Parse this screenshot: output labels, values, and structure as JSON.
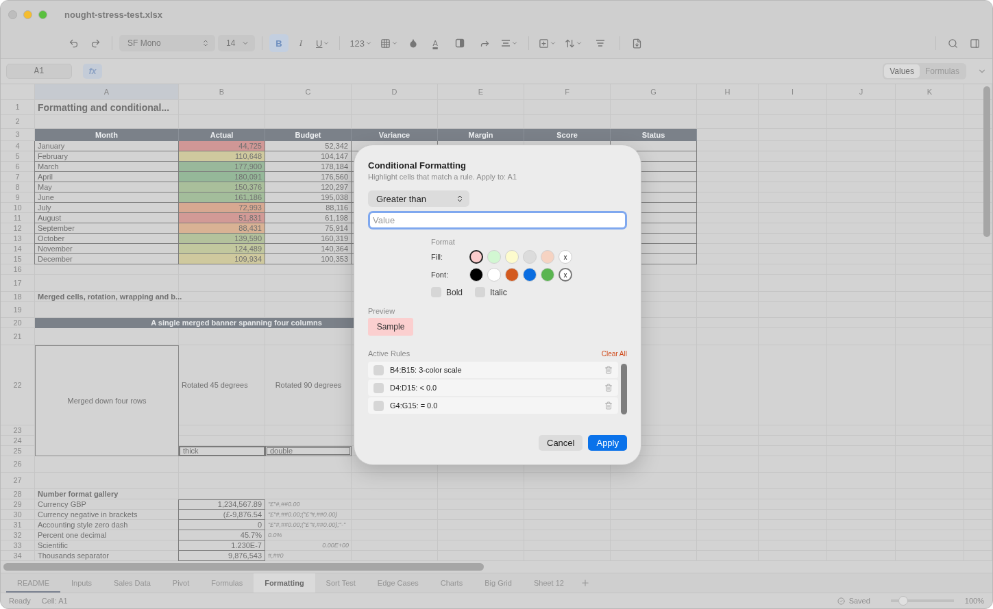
{
  "window": {
    "title": "nought-stress-test.xlsx"
  },
  "toolbar": {
    "font_name": "SF Mono",
    "font_size": "14",
    "bold": {
      "label": "B",
      "selected": true
    },
    "italic": {
      "label": "I",
      "selected": false
    },
    "underline": {
      "label": "U",
      "selected": false
    },
    "number_format": "123",
    "font_color_letter": "A"
  },
  "formula_bar": {
    "cell_ref": "A1",
    "fx": "fx",
    "view_toggle": [
      {
        "label": "Values",
        "selected": true
      },
      {
        "label": "Formulas",
        "selected": false
      }
    ]
  },
  "sheet": {
    "columns": [
      {
        "label": "A",
        "selected": true
      },
      {
        "label": "B",
        "selected": false
      },
      {
        "label": "C",
        "selected": false
      },
      {
        "label": "D",
        "selected": false
      },
      {
        "label": "E",
        "selected": false
      },
      {
        "label": "F",
        "selected": false
      },
      {
        "label": "G",
        "selected": false
      },
      {
        "label": "H",
        "selected": false
      },
      {
        "label": "I",
        "selected": false
      },
      {
        "label": "J",
        "selected": false
      },
      {
        "label": "K",
        "selected": false
      }
    ],
    "row_numbers": [
      "1",
      "2",
      "3",
      "4",
      "5",
      "6",
      "7",
      "8",
      "9",
      "10",
      "11",
      "12",
      "13",
      "14",
      "15",
      "16",
      "17",
      "18",
      "19",
      "20",
      "21",
      "22",
      "23",
      "24",
      "25",
      "26",
      "27",
      "28",
      "29",
      "30",
      "31",
      "32",
      "33",
      "34"
    ],
    "title": "Formatting and conditional...",
    "table": {
      "headers": [
        "Month",
        "Actual",
        "Budget",
        "Variance",
        "Margin",
        "Score",
        "Status"
      ],
      "rows": [
        {
          "month": "January",
          "actual": "44,725",
          "color": "#d09796",
          "budget": "52,342"
        },
        {
          "month": "February",
          "actual": "110,648",
          "color": "#cfc99e",
          "budget": "104,147"
        },
        {
          "month": "March",
          "actual": "177,900",
          "color": "#99b89b",
          "budget": "178,184"
        },
        {
          "month": "April",
          "actual": "180,091",
          "color": "#95b899",
          "budget": "176,560"
        },
        {
          "month": "May",
          "actual": "150,376",
          "color": "#a9bf9b",
          "budget": "120,297"
        },
        {
          "month": "June",
          "actual": "161,186",
          "color": "#a3bd9b",
          "budget": "195,038"
        },
        {
          "month": "July",
          "actual": "72,993",
          "color": "#d7a891",
          "budget": "88,116"
        },
        {
          "month": "August",
          "actual": "51,831",
          "color": "#d29a96",
          "budget": "61,198"
        },
        {
          "month": "September",
          "actual": "88,431",
          "color": "#d9b294",
          "budget": "75,914"
        },
        {
          "month": "October",
          "actual": "139,590",
          "color": "#b4c29c",
          "budget": "160,319"
        },
        {
          "month": "November",
          "actual": "124,489",
          "color": "#c2c89e",
          "budget": "140,364"
        },
        {
          "month": "December",
          "actual": "109,934",
          "color": "#cfc99e",
          "budget": "100,353"
        }
      ]
    },
    "merged": {
      "title": "Merged cells, rotation, wrapping and b...",
      "banner": "A single merged banner spanning four columns",
      "merged_cell": "Merged down four rows",
      "rotated": [
        "Rotated 45 degrees",
        "Rotated 90 degrees"
      ],
      "borders": [
        "thick",
        "double"
      ]
    },
    "number_formats": {
      "title": "Number format gallery",
      "rows": [
        {
          "label": "Currency GBP",
          "value": "1,234,567.89",
          "format": "\"£\"#,##0.00",
          "right_aligned": false
        },
        {
          "label": "Currency negative in brackets",
          "value": "(£-9,876.54",
          "format": "\"£\"#,##0.00;(\"£\"#,##0.00)",
          "right_aligned": false
        },
        {
          "label": "Accounting style zero dash",
          "value": "0",
          "format": "\"£\"#,##0.00;(\"£\"#,##0.00);\"-\"",
          "right_aligned": false
        },
        {
          "label": "Percent one decimal",
          "value": "45.7%",
          "format": "0.0%",
          "right_aligned": false
        },
        {
          "label": "Scientific",
          "value": "1.230E-7",
          "format": "0.00E+00",
          "right_aligned": true
        },
        {
          "label": "Thousands separator",
          "value": "9,876,543",
          "format": "#,##0",
          "right_aligned": false
        }
      ]
    }
  },
  "dialog": {
    "title": "Conditional Formatting",
    "subtitle": "Highlight cells that match a rule. Apply to: A1",
    "condition": "Greater than",
    "value_placeholder": "Value",
    "format_label": "Format",
    "fill_label": "Fill:",
    "fills": [
      {
        "color": "#fbcccc",
        "selected": true
      },
      {
        "color": "#d2f7d2",
        "selected": false
      },
      {
        "color": "#fdfbcd",
        "selected": false
      },
      {
        "color": "#dcdcdc",
        "selected": false
      },
      {
        "color": "#f6d3c2",
        "selected": false
      }
    ],
    "fill_none": {
      "label": "x",
      "selected": false
    },
    "font_label": "Font:",
    "fonts": [
      {
        "color": "#000000",
        "selected": false
      },
      {
        "color": "#ffffff",
        "selected": false
      },
      {
        "color": "#d35a1f",
        "selected": false
      },
      {
        "color": "#0a6de0",
        "selected": false
      },
      {
        "color": "#5ab550",
        "selected": false
      }
    ],
    "font_none": {
      "label": "x",
      "selected": true
    },
    "styles": [
      {
        "label": "Bold",
        "checked": false
      },
      {
        "label": "Italic",
        "checked": false
      }
    ],
    "preview_label": "Preview",
    "preview_text": "Sample",
    "rules_label": "Active Rules",
    "clear_all": "Clear All",
    "rules": [
      {
        "text": "B4:B15: 3-color scale",
        "checked": false
      },
      {
        "text": "D4:D15: < 0.0",
        "checked": false
      },
      {
        "text": "G4:G15: = 0.0",
        "checked": false
      }
    ],
    "buttons": [
      {
        "label": "Cancel",
        "kind": "secondary"
      },
      {
        "label": "Apply",
        "kind": "primary"
      }
    ]
  },
  "sheet_tabs": [
    {
      "label": "README",
      "selected": false,
      "focused": true
    },
    {
      "label": "Inputs",
      "selected": false,
      "focused": false
    },
    {
      "label": "Sales Data",
      "selected": false,
      "focused": false
    },
    {
      "label": "Pivot",
      "selected": false,
      "focused": false
    },
    {
      "label": "Formulas",
      "selected": false,
      "focused": false
    },
    {
      "label": "Formatting",
      "selected": true,
      "focused": false
    },
    {
      "label": "Sort Test",
      "selected": false,
      "focused": false
    },
    {
      "label": "Edge Cases",
      "selected": false,
      "focused": false
    },
    {
      "label": "Charts",
      "selected": false,
      "focused": false
    },
    {
      "label": "Big Grid",
      "selected": false,
      "focused": false
    },
    {
      "label": "Sheet 12",
      "selected": false,
      "focused": false
    }
  ],
  "status_bar": {
    "state": "Ready",
    "cell": "Cell: A1",
    "saved": "Saved",
    "zoom": {
      "level": 0.2
    },
    "zoom_text": "100%"
  }
}
